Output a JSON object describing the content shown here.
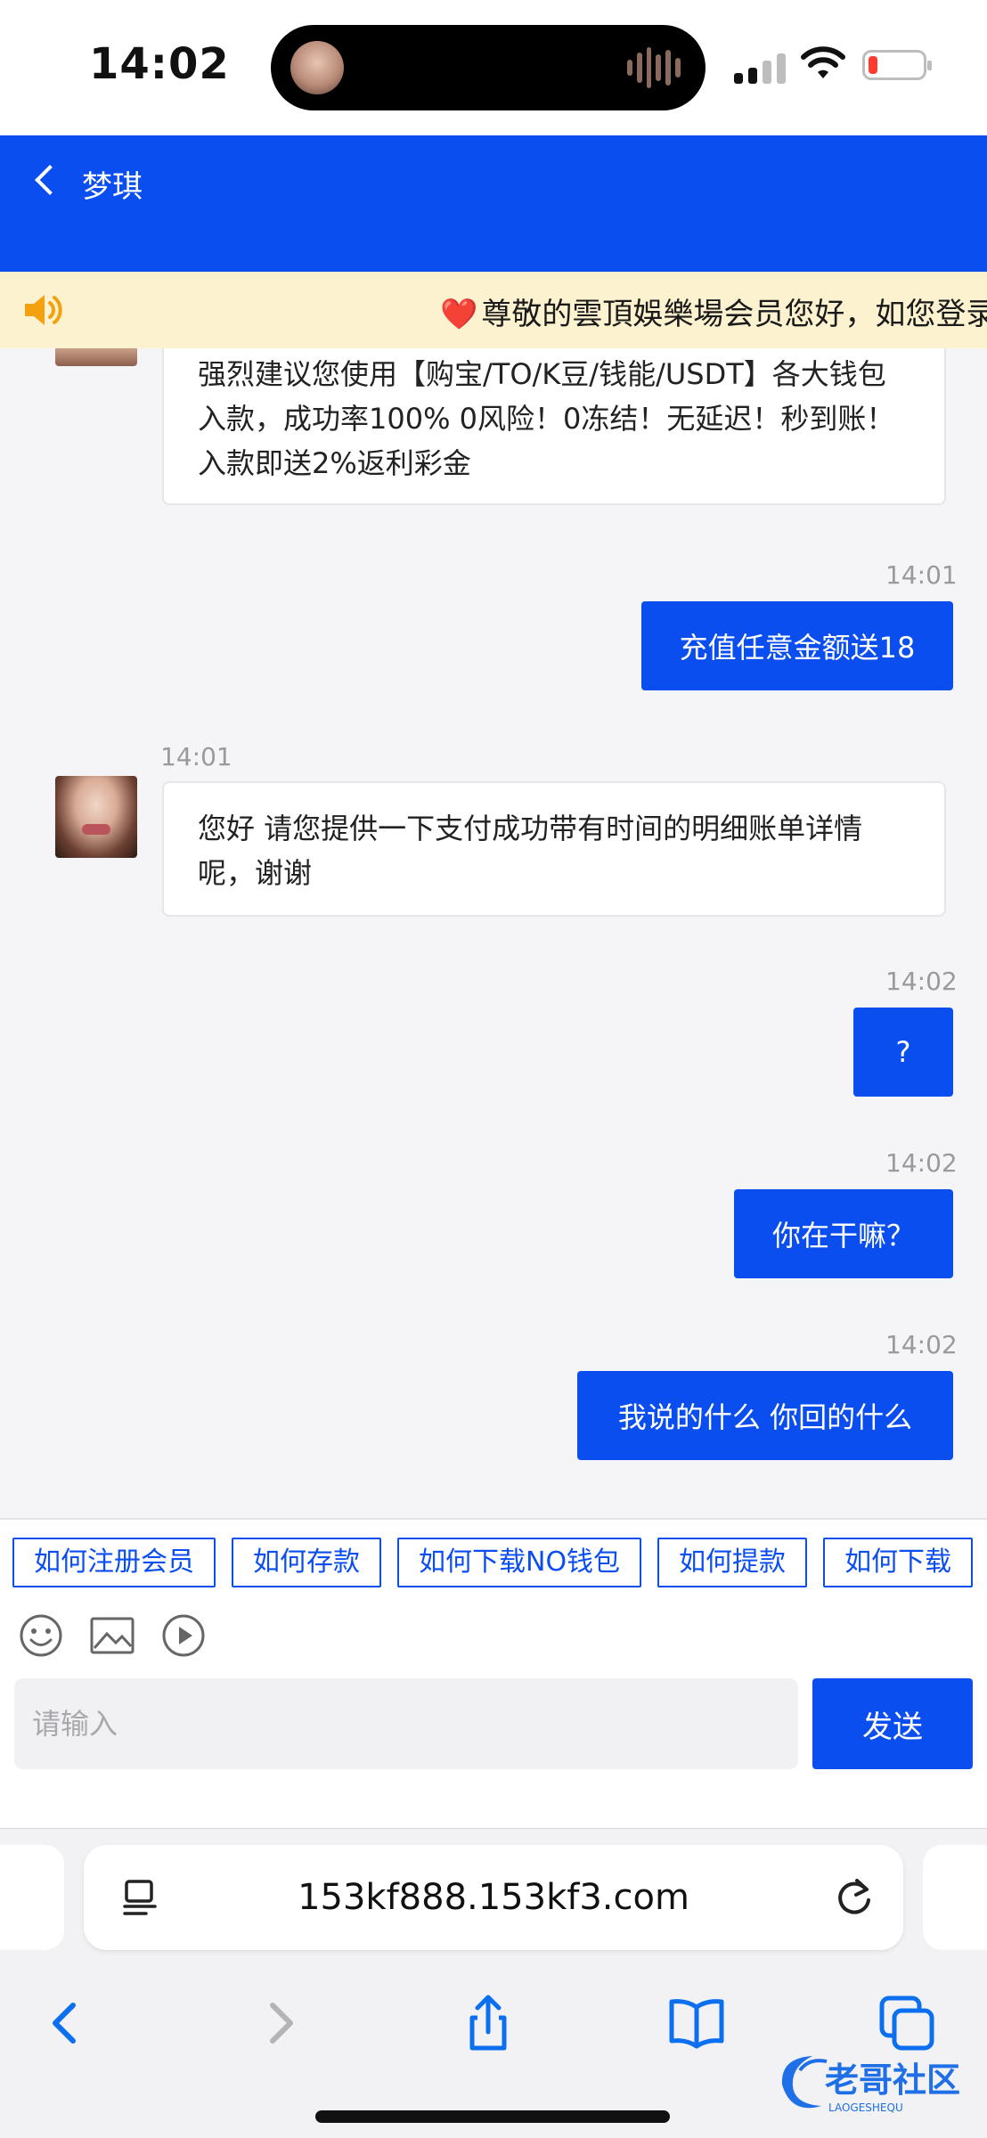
{
  "status_bar": {
    "time": "14:02"
  },
  "header": {
    "title": "梦琪"
  },
  "notice": {
    "text": "尊敬的雲頂娛樂場会员您好，如您登录"
  },
  "messages": [
    {
      "from": "agent",
      "text": "强烈建议您使用【购宝/TO/K豆/钱能/USDT】各大钱包入款，成功率100% 0风险！0冻结！无延迟！秒到账！入款即送2%返利彩金"
    },
    {
      "from": "user",
      "time": "14:01",
      "text": "充值任意金额送18"
    },
    {
      "from": "agent",
      "time": "14:01",
      "text": "您好 请您提供一下支付成功带有时间的明细账单详情呢，谢谢"
    },
    {
      "from": "user",
      "time": "14:02",
      "text": "?"
    },
    {
      "from": "user",
      "time": "14:02",
      "text": "你在干嘛？"
    },
    {
      "from": "user",
      "time": "14:02",
      "text": "我说的什么 你回的什么"
    }
  ],
  "quick_replies": [
    "如何注册会员",
    "如何存款",
    "如何下载NO钱包",
    "如何提款",
    "如何下载"
  ],
  "composer": {
    "placeholder": "请输入",
    "send_label": "发送"
  },
  "browser": {
    "url": "153kf888.153kf3.com"
  },
  "watermark": {
    "text": "老哥社区",
    "subtext": "LAOGESHEQU"
  },
  "colors": {
    "primary": "#0b4ef0",
    "notice_bg": "#fdf2d0",
    "heart": "#e8262d"
  }
}
